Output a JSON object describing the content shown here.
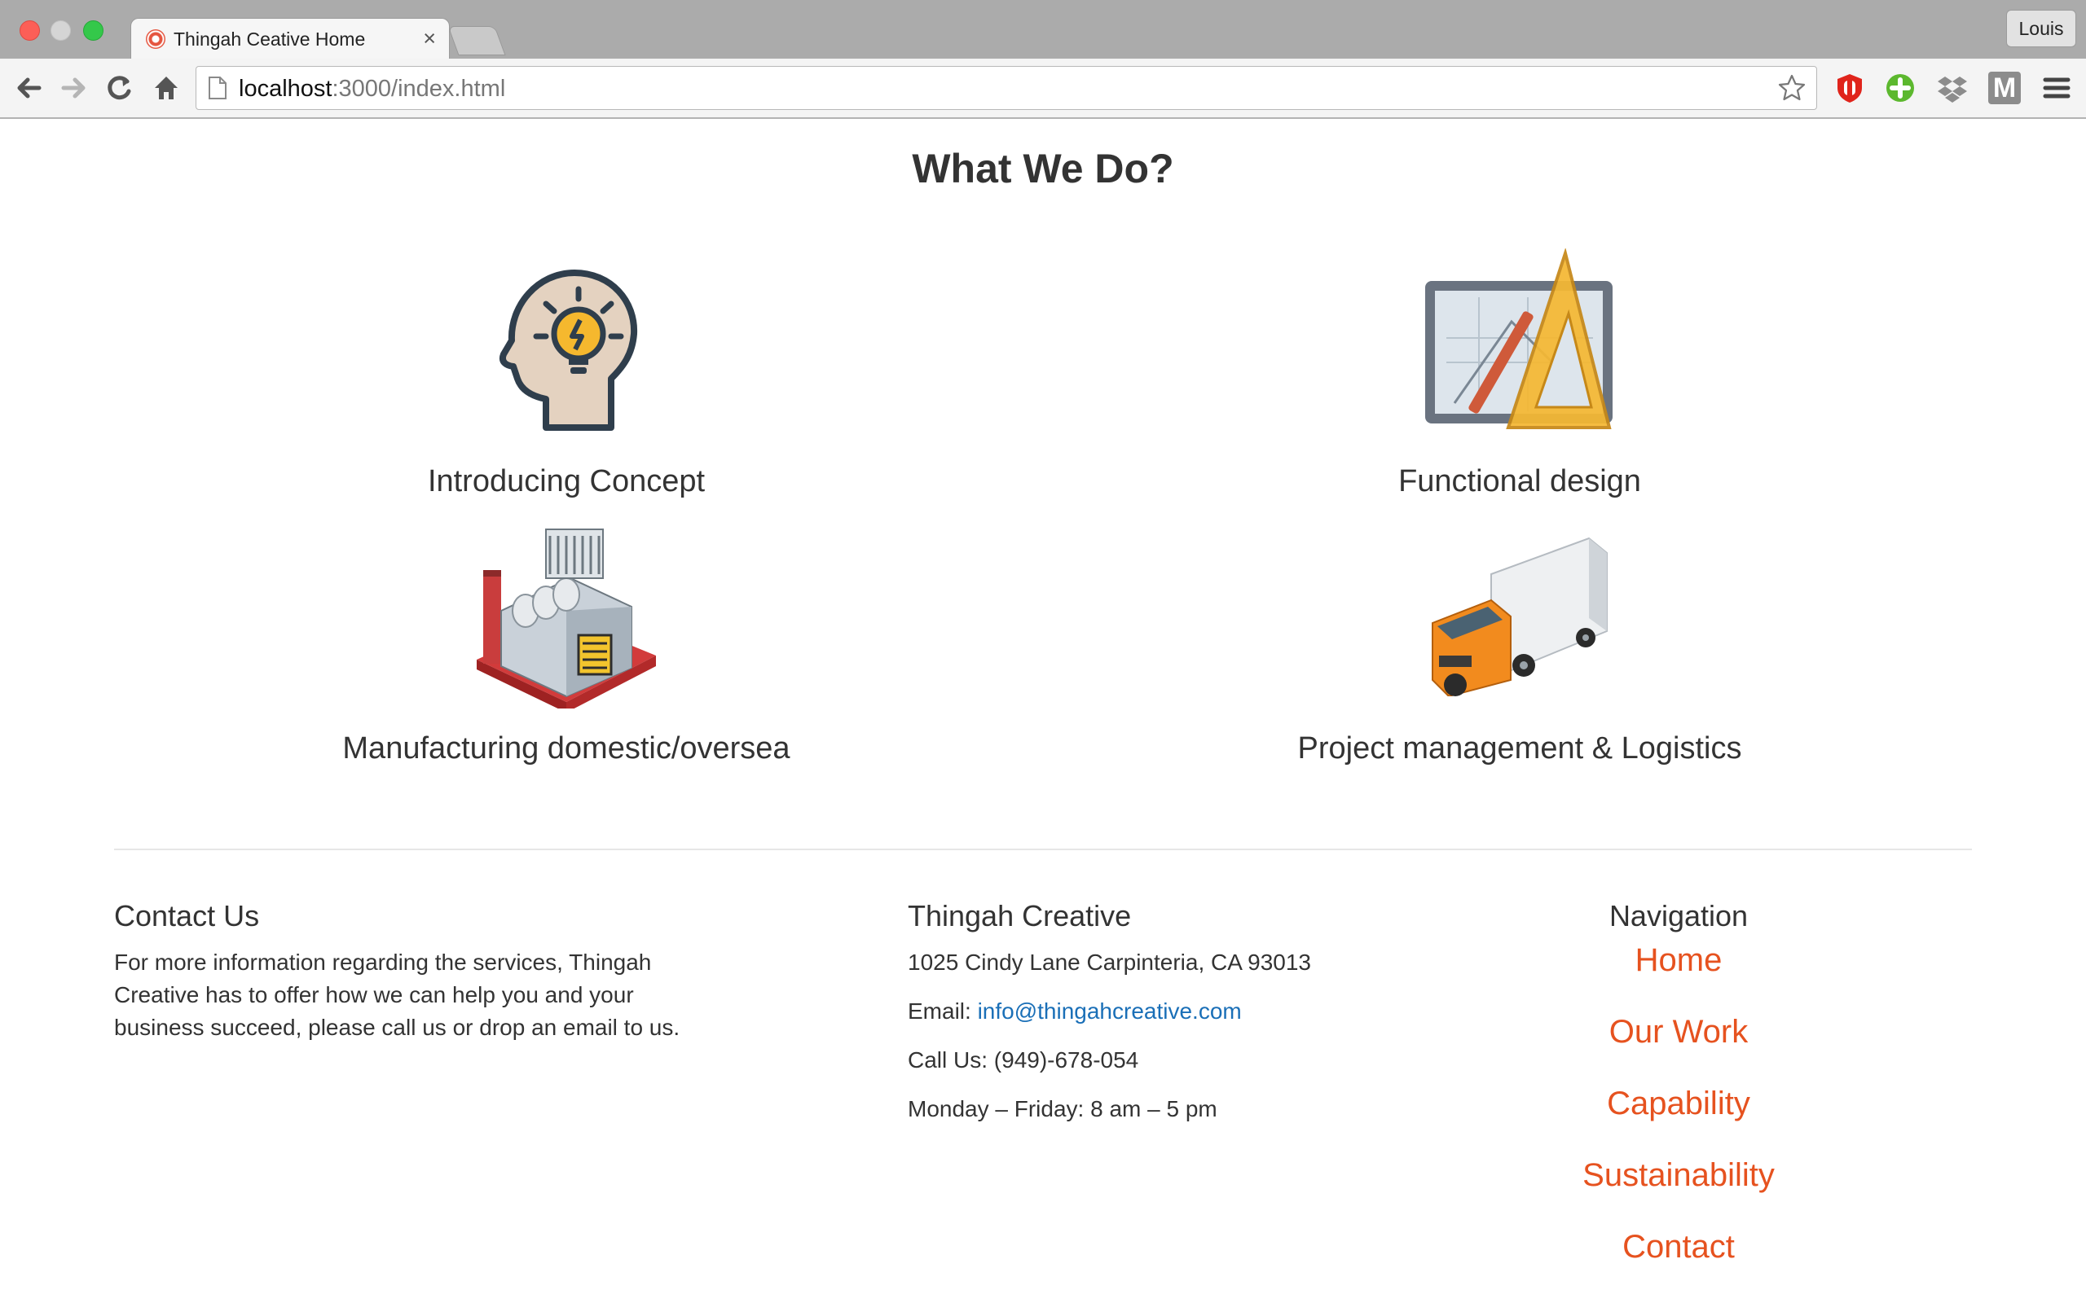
{
  "browser": {
    "tab_title": "Thingah Ceative Home",
    "tab_close": "×",
    "url_host": "localhost",
    "url_path": ":3000/index.html",
    "profile_name": "Louis",
    "extensions": [
      "ublock-icon",
      "add-plus-icon",
      "dropbox-icon",
      "m-extension-icon"
    ],
    "m_extension_letter": "M"
  },
  "services": {
    "title": "What We Do?",
    "items": [
      {
        "label": "Introducing Concept",
        "icon": "lightbulb-head-icon"
      },
      {
        "label": "Functional design",
        "icon": "design-tools-icon"
      },
      {
        "label": "Manufacturing domestic/oversea",
        "icon": "factory-icon"
      },
      {
        "label": "Project management & Logistics",
        "icon": "truck-icon"
      }
    ]
  },
  "footer": {
    "contact": {
      "title": "Contact Us",
      "text": "For more information regarding the services, Thingah Creative has to offer how we can help you and your business succeed, please call us or drop an email to us."
    },
    "company": {
      "title": "Thingah Creative",
      "address": "1025 Cindy Lane Carpinteria, CA 93013",
      "email_label": "Email: ",
      "email": "info@thingahcreative.com",
      "phone": "Call Us: (949)-678-054",
      "hours": "Monday – Friday: 8 am – 5 pm"
    },
    "navigation": {
      "title": "Navigation",
      "links": [
        "Home",
        "Our Work",
        "Capability",
        "Sustainability",
        "Contact"
      ]
    }
  },
  "colors": {
    "nav_link": "#e6521f",
    "email_link": "#1a6fb7",
    "text": "#333333"
  }
}
